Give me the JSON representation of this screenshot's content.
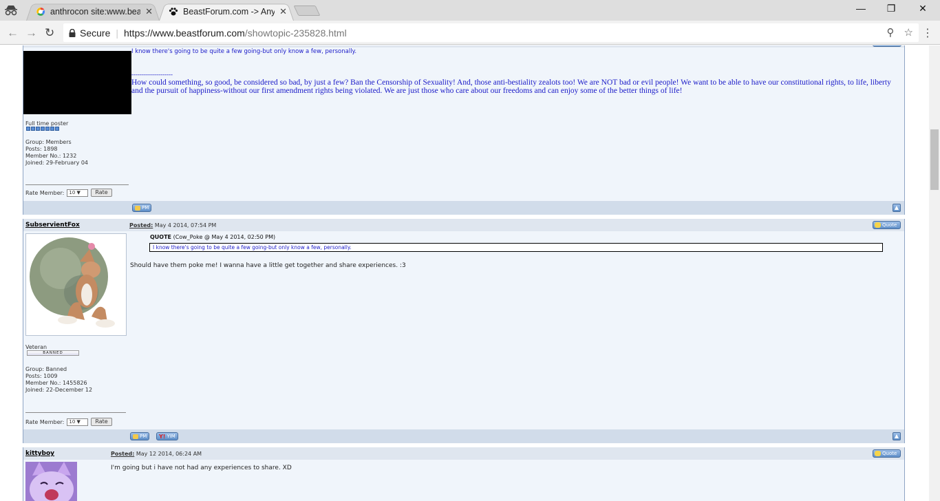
{
  "browser": {
    "tabs": [
      {
        "title": "anthrocon site:www.beas",
        "icon": "google-icon"
      },
      {
        "title": "BeastForum.com -> Any",
        "icon": "paw-icon"
      }
    ],
    "secure_label": "Secure",
    "url_domain": "https://www.beastforum.com",
    "url_path": "/showtopic-235828.html"
  },
  "posts": [
    {
      "body_line": "I know there's going to be quite a few going-but only know a few, personally.",
      "sig_dash": "--------------------",
      "signature": "How could something, so good, be considered so bad, by just a few? Ban the Censorship of Sexuality! And, those anti-bestiality zealots too! We are NOT bad or evil people! We want to be able to have our constitutional rights, to life, liberty and the pursuit of happiness-without our first amendment rights being violated. We are just those who care about our freedoms and can enjoy some of the better things of life!",
      "rank": "Full time poster",
      "group": "Group: Members",
      "posts": "Posts: 1898",
      "member_no": "Member No.: 1232",
      "joined": "Joined: 29-February 04",
      "rate_label": "Rate Member:",
      "rate_value": "10",
      "rate_button": "Rate",
      "pm": "PM"
    },
    {
      "username": "SubservientFox",
      "posted_label": "Posted:",
      "posted_date": "May 4 2014, 07:54 PM",
      "quote_button": "Quote",
      "quote_label": "QUOTE",
      "quote_meta": "(Cow_Poke @ May 4 2014, 02:50 PM)",
      "quote_text": "I know there's going to be quite a few going-but only know a few, personally.",
      "body": "Should have them poke me! I wanna have a little get together and share experiences. :3",
      "rank": "Veteran",
      "badge": "BANNED",
      "group": "Group: Banned",
      "posts": "Posts: 1009",
      "member_no": "Member No.: 1455826",
      "joined": "Joined: 22-December 12",
      "rate_label": "Rate Member:",
      "rate_value": "10",
      "rate_button": "Rate",
      "pm": "PM",
      "yim": "YIM"
    },
    {
      "username": "kittyboy",
      "posted_label": "Posted:",
      "posted_date": "May 12 2014, 06:24 AM",
      "quote_button": "Quote",
      "body": "I'm going but i have not had any experiences to share. XD"
    }
  ]
}
